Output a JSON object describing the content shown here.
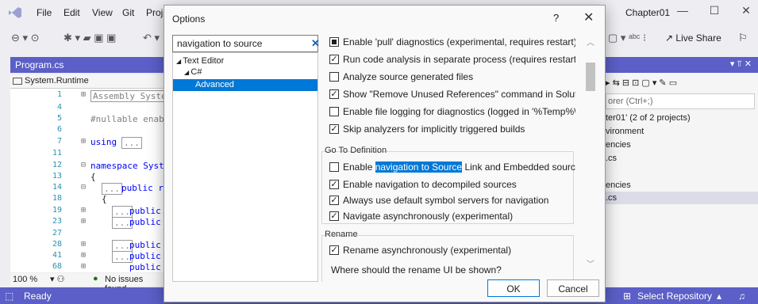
{
  "vs": {
    "menu": [
      "File",
      "Edit",
      "View",
      "Git",
      "Proj"
    ],
    "solution_title": "Chapter01",
    "live_share": "Live Share",
    "document_tab": "Program.cs",
    "nav_scope": "System.Runtime",
    "zoom": "100 %",
    "issues": "No issues found",
    "status": "Ready",
    "select_repo": "Select Repository",
    "code_lines": [
      {
        "n": "1",
        "text": "Assembly Syste"
      },
      {
        "n": "4",
        "text": ""
      },
      {
        "n": "5",
        "text": "#nullable enab"
      },
      {
        "n": "6",
        "text": ""
      },
      {
        "n": "7",
        "text": "using"
      },
      {
        "n": "11",
        "text": ""
      },
      {
        "n": "12",
        "text": "namespace Syst"
      },
      {
        "n": "13",
        "text": "{"
      },
      {
        "n": "14",
        "text": "public re"
      },
      {
        "n": "18",
        "text": "{"
      },
      {
        "n": "19",
        "text": "public"
      },
      {
        "n": "23",
        "text": "public"
      },
      {
        "n": "27",
        "text": ""
      },
      {
        "n": "28",
        "text": "public"
      },
      {
        "n": "41",
        "text": "public"
      },
      {
        "n": "68",
        "text": "public"
      }
    ],
    "solution_explorer": {
      "search_placeholder": "orer (Ctrl+;)",
      "lines": [
        "ter01' (2 of 2 projects)",
        "vironment",
        "encies",
        ".cs",
        "",
        "encies",
        ".cs"
      ]
    }
  },
  "dialog": {
    "title": "Options",
    "help": "?",
    "search_value": "navigation to source",
    "tree": {
      "root": "Text Editor",
      "child": "C#",
      "selected": "Advanced"
    },
    "options_top": [
      {
        "label": "Enable 'pull' diagnostics (experimental, requires restart)",
        "state": "indeterminate"
      },
      {
        "label": "Run code analysis in separate process (requires restart)",
        "state": "checked"
      },
      {
        "label": "Analyze source generated files",
        "state": "unchecked"
      },
      {
        "label": "Show \"Remove Unused References\" command in Solution Exp",
        "state": "checked"
      },
      {
        "label": "Enable file logging for diagnostics (logged in '%Temp%\\Roslyi",
        "state": "unchecked"
      },
      {
        "label": "Skip analyzers for implicitly triggered builds",
        "state": "checked"
      }
    ],
    "go_to_definition": {
      "header": "Go To Definition",
      "first_pre": "Enable ",
      "first_highlight": "navigation to Source",
      "first_post": " Link and Embedded sources",
      "options": [
        {
          "label": "Enable navigation to decompiled sources",
          "state": "checked"
        },
        {
          "label": "Always use default symbol servers for navigation",
          "state": "checked"
        },
        {
          "label": "Navigate asynchronously (experimental)",
          "state": "checked"
        }
      ]
    },
    "rename": {
      "header": "Rename",
      "option": "Rename asynchronously (experimental)",
      "question": "Where should the rename UI be shown?"
    },
    "ok": "OK",
    "cancel": "Cancel"
  },
  "colors": {
    "accent": "#5b5fc7",
    "selection": "#0078d7"
  }
}
